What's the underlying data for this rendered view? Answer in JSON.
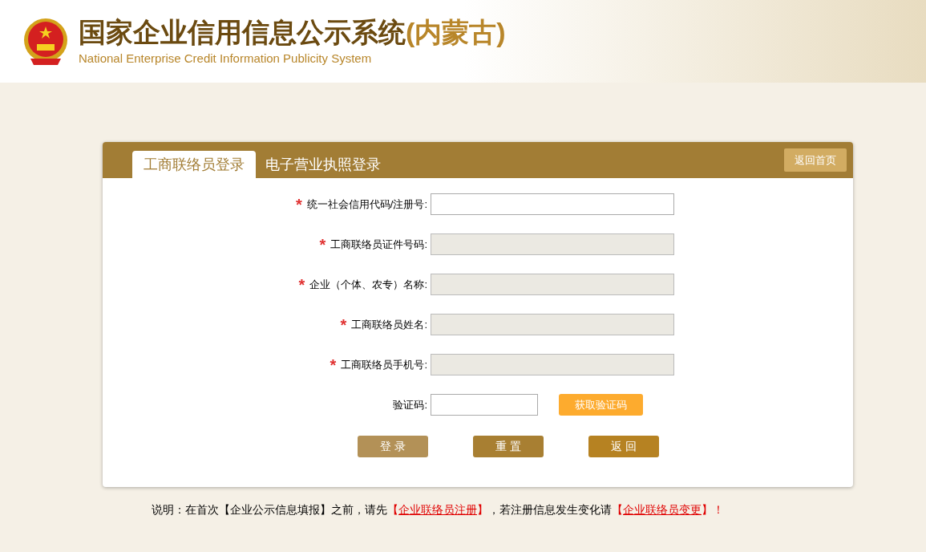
{
  "header": {
    "title": "国家企业信用信息公示系统",
    "region": "(内蒙古)",
    "subtitle": "National Enterprise Credit Information Publicity System"
  },
  "tabs": [
    {
      "label": "工商联络员登录",
      "selected": true
    },
    {
      "label": "电子营业执照登录",
      "selected": false
    }
  ],
  "home_button": "返回首页",
  "fields": [
    {
      "marker": "*",
      "label": "统一社会信用代码/注册号:",
      "disabled": false
    },
    {
      "marker": "*",
      "label": "工商联络员证件号码:",
      "disabled": true
    },
    {
      "marker": "*",
      "label": "企业（个体、农专）名称:",
      "disabled": true
    },
    {
      "marker": "*",
      "label": "工商联络员姓名:",
      "disabled": true
    },
    {
      "marker": "*",
      "label": "工商联络员手机号:",
      "disabled": true
    }
  ],
  "captcha": {
    "label": "验证码:",
    "button": "获取验证码"
  },
  "buttons": [
    {
      "label": "登 录",
      "kind": "login"
    },
    {
      "label": "重 置",
      "kind": "reset"
    },
    {
      "label": "返 回",
      "kind": "back"
    }
  ],
  "note": [
    {
      "kind": "text",
      "text": "说明：在首次【企业公示信息填报】之前，请先"
    },
    {
      "kind": "mark",
      "text": "【"
    },
    {
      "kind": "link",
      "text": "企业联络员注册"
    },
    {
      "kind": "mark",
      "text": "】"
    },
    {
      "kind": "text",
      "text": "，若注册信息发生变化请"
    },
    {
      "kind": "mark",
      "text": "【"
    },
    {
      "kind": "link",
      "text": "企业联络员变更"
    },
    {
      "kind": "mark",
      "text": "】"
    },
    {
      "kind": "mark",
      "text": "！"
    }
  ]
}
